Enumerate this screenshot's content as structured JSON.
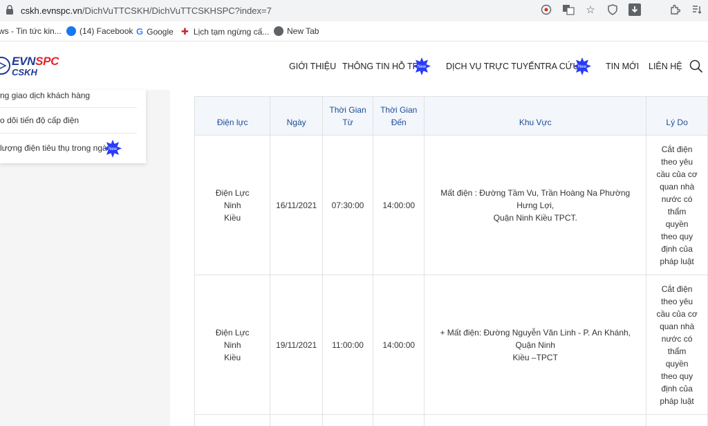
{
  "browser": {
    "url_host": "cskh.evnspc.vn",
    "url_path": "/DichVuTTCSKH/DichVuTTCSKHSPC?index=7",
    "icons": [
      "lock-icon",
      "location-icon",
      "translate-icon",
      "star-icon",
      "shield-icon",
      "download-icon",
      "extensions-icon",
      "reading-list-icon"
    ]
  },
  "bookmarks": [
    {
      "label": "ws - Tin tức kin...",
      "icon": "news-icon"
    },
    {
      "label": "(14) Facebook",
      "icon": "facebook-icon"
    },
    {
      "label": "Google",
      "icon": "google-icon"
    },
    {
      "label": "Lịch tạm ngừng cấ...",
      "icon": "evn-icon"
    },
    {
      "label": "New Tab",
      "icon": "globe-icon"
    }
  ],
  "site": {
    "logo_evn": "EVN",
    "logo_spc": "SPC",
    "logo_cskh": "CSKH",
    "nav": [
      "GIỚI THIỆU",
      "THÔNG TIN HỖ TRỢ",
      "DỊCH VỤ TRỰC TUYẾN",
      "TRA CỨU",
      "TIN MỚI",
      "LIÊN HỆ"
    ],
    "badge_text": "New",
    "colors": {
      "brand_blue": "#1f3a93",
      "brand_red": "#e4222b",
      "header_text": "#1a4d96",
      "badge": "#2a3cf5"
    }
  },
  "sidebar": {
    "items": [
      "ng giao dịch khách hàng",
      "o dõi tiến độ cấp điện",
      "lượng điện tiêu thụ trong ngày"
    ]
  },
  "table": {
    "headers": [
      "Điện lực",
      "Ngày",
      "Thời Gian Từ",
      "Thời Gian Đến",
      "Khu Vực",
      "Lý Do"
    ],
    "header_lines": {
      "from_1": "Thời Gian",
      "from_2": "Từ",
      "to_1": "Thời Gian",
      "to_2": "Đến"
    },
    "rows": [
      {
        "unit_1": "Điện Lực Ninh",
        "unit_2": "Kiều",
        "date": "16/11/2021",
        "from": "07:30:00",
        "to": "14:00:00",
        "area_1": "Mất điện : Đường Tầm Vu, Trần Hoàng Na Phường Hưng Lợi,",
        "area_2": "Quận Ninh Kiều TPCT.",
        "reason": [
          "Cắt điện",
          "theo yêu",
          "cầu của cơ",
          "quan nhà",
          "nước có",
          "thẩm",
          "quyền",
          "theo quy",
          "định của",
          "pháp luật"
        ]
      },
      {
        "unit_1": "Điện Lực Ninh",
        "unit_2": "Kiều",
        "date": "19/11/2021",
        "from": "11:00:00",
        "to": "14:00:00",
        "area_1": "+ Mất điện: Đường Nguyễn Văn Linh - P. An Khánh, Quận Ninh",
        "area_2": "Kiều –TPCT",
        "reason": [
          "Cắt điện",
          "theo yêu",
          "cầu của cơ",
          "quan nhà",
          "nước có",
          "thẩm",
          "quyền",
          "theo quy",
          "định của",
          "pháp luật"
        ]
      }
    ]
  }
}
